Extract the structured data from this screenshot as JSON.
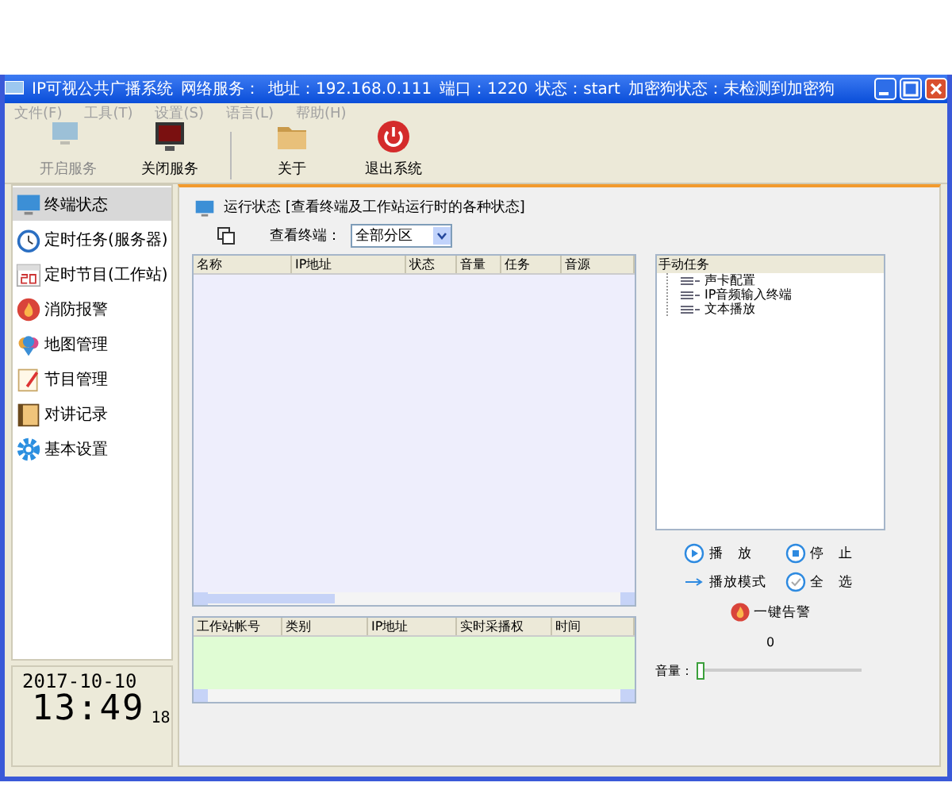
{
  "window": {
    "title": "IP可视公共广播系统",
    "status_texts": [
      "网络服务：",
      "地址：192.168.0.111",
      "端口：1220",
      "状态：start",
      "加密狗状态：未检测到加密狗"
    ]
  },
  "menu": [
    {
      "label": "文件(F)",
      "disabled": true
    },
    {
      "label": "工具(T)",
      "disabled": true
    },
    {
      "label": "设置(S)",
      "disabled": true
    },
    {
      "label": "语言(L)",
      "disabled": true
    },
    {
      "label": "帮助(H)",
      "disabled": true
    }
  ],
  "toolbar": [
    {
      "label": "开启服务",
      "kind": "monitor",
      "disabled": true
    },
    {
      "label": "关闭服务",
      "kind": "monitor-off",
      "disabled": false
    },
    {
      "label": "关于",
      "kind": "folder",
      "disabled": false
    },
    {
      "label": "退出系统",
      "kind": "power",
      "disabled": false
    }
  ],
  "sidebar": {
    "items": [
      {
        "label": "终端状态",
        "kind": "monitor",
        "selected": true
      },
      {
        "label": "定时任务(服务器)",
        "kind": "clock",
        "selected": false
      },
      {
        "label": "定时节目(工作站)",
        "kind": "calendar",
        "selected": false
      },
      {
        "label": "消防报警",
        "kind": "fire",
        "selected": false
      },
      {
        "label": "地图管理",
        "kind": "map",
        "selected": false
      },
      {
        "label": "节目管理",
        "kind": "note",
        "selected": false
      },
      {
        "label": "对讲记录",
        "kind": "book",
        "selected": false
      },
      {
        "label": "基本设置",
        "kind": "gear",
        "selected": false
      }
    ],
    "clock": {
      "date": "2017-10-10",
      "time": "13:49",
      "seconds": "18"
    }
  },
  "panel": {
    "title": "运行状态 [查看终端及工作站运行时的各种状态]",
    "filter_label": "查看终端：",
    "filter_value": "全部分区",
    "terminal_table": {
      "columns": [
        "名称",
        "IP地址",
        "状态",
        "音量",
        "任务",
        "音源"
      ]
    },
    "workstation_table": {
      "columns": [
        "工作站帐号",
        "类别",
        "IP地址",
        "实时采播权",
        "时间"
      ]
    },
    "manual_tasks": {
      "heading": "手动任务",
      "items": [
        "声卡配置",
        "IP音频输入终端",
        "文本播放"
      ]
    },
    "buttons": [
      {
        "label": "播　放",
        "kind": "play"
      },
      {
        "label": "停　止",
        "kind": "stop"
      },
      {
        "label": "播放模式",
        "kind": "arrow"
      },
      {
        "label": "全　选",
        "kind": "check"
      }
    ],
    "alarm_button": "一键告警",
    "volume_value": "0",
    "volume_label": "音量：",
    "volume": {
      "level": 0
    }
  }
}
